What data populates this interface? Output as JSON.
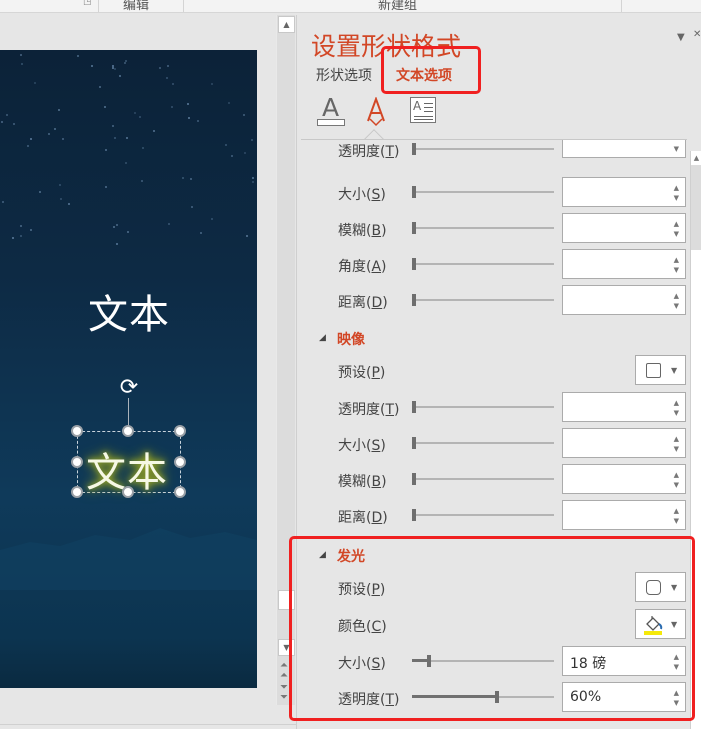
{
  "ribbon": {
    "groups": [
      "编辑",
      "新建组"
    ]
  },
  "slide": {
    "text_plain": "文本",
    "text_selected": "文本"
  },
  "pane": {
    "title": "设置形状格式",
    "tabs": [
      {
        "label": "形状选项",
        "active": false
      },
      {
        "label": "文本选项",
        "active": true
      }
    ],
    "icons": [
      "text-fill-outline-icon",
      "text-effects-icon",
      "textbox-layout-icon"
    ],
    "shadow_section": {
      "rows": [
        {
          "label": "透明度",
          "key": "T",
          "value": ""
        },
        {
          "label": "大小",
          "key": "S",
          "value": ""
        },
        {
          "label": "模糊",
          "key": "B",
          "value": ""
        },
        {
          "label": "角度",
          "key": "A",
          "value": ""
        },
        {
          "label": "距离",
          "key": "D",
          "value": ""
        }
      ]
    },
    "reflection_section": {
      "title": "映像",
      "preset_label": "预设",
      "preset_key": "P",
      "rows": [
        {
          "label": "透明度",
          "key": "T",
          "value": ""
        },
        {
          "label": "大小",
          "key": "S",
          "value": ""
        },
        {
          "label": "模糊",
          "key": "B",
          "value": ""
        },
        {
          "label": "距离",
          "key": "D",
          "value": ""
        }
      ]
    },
    "glow_section": {
      "title": "发光",
      "preset_label": "预设",
      "preset_key": "P",
      "color_label": "颜色",
      "color_key": "C",
      "color_value": "#f5e90a",
      "size_label": "大小",
      "size_key": "S",
      "size_value": "18 磅",
      "size_slider_fraction": 0.12,
      "transparency_label": "透明度",
      "transparency_key": "T",
      "transparency_value": "60%",
      "transparency_slider_fraction": 0.6
    }
  },
  "colors": {
    "accent": "#d24726",
    "highlight": "#f02020"
  }
}
